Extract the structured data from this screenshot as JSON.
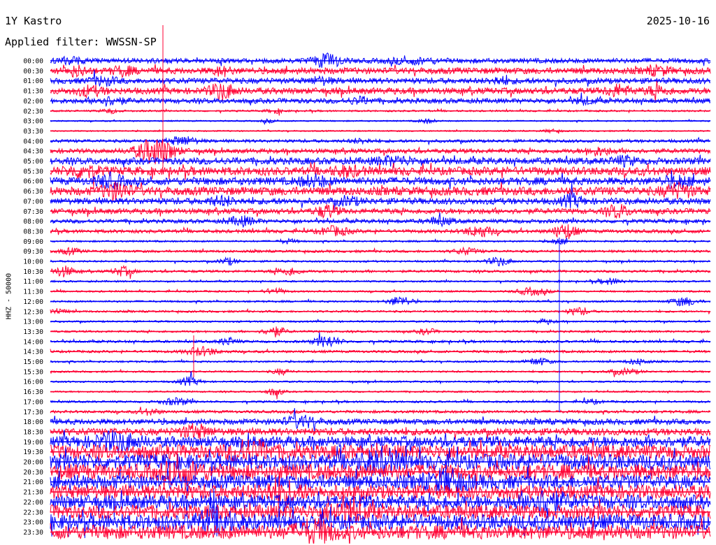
{
  "header": {
    "station": "1Y Kastro",
    "date": "2025-10-16",
    "filter": "Applied filter: WWSSN-SP"
  },
  "chart_data": {
    "type": "line",
    "title": "1Y Kastro",
    "subtitle": "Applied filter: WWSSN-SP",
    "ylabel": "HHZ - 50000",
    "xlabel": "",
    "x_range": [
      0,
      30
    ],
    "grid": false,
    "legend": "none",
    "colors": {
      "even_rows": "#0000ff",
      "odd_rows": "#ff0033",
      "text": "#000000",
      "background": "#ffffff"
    },
    "tick_labels": [
      "00:00",
      "00:30",
      "01:00",
      "01:30",
      "02:00",
      "02:30",
      "03:00",
      "03:30",
      "04:00",
      "04:30",
      "05:00",
      "05:30",
      "06:00",
      "06:30",
      "07:00",
      "07:30",
      "08:00",
      "08:30",
      "09:00",
      "09:30",
      "10:00",
      "10:30",
      "11:00",
      "11:30",
      "12:00",
      "12:30",
      "13:00",
      "13:30",
      "14:00",
      "14:30",
      "15:00",
      "15:30",
      "16:00",
      "16:30",
      "17:00",
      "17:30",
      "18:00",
      "18:30",
      "19:00",
      "19:30",
      "20:00",
      "20:30",
      "21:00",
      "21:30",
      "22:00",
      "22:30",
      "23:00",
      "23:30"
    ],
    "series": [
      {
        "label": "00:00",
        "noise": 3.5,
        "events": [
          [
            0.42,
            1.4,
            9
          ],
          [
            0.55,
            2.8,
            3
          ],
          [
            0.03,
            1.2,
            4
          ]
        ]
      },
      {
        "label": "00:30",
        "noise": 4.5,
        "events": [
          [
            0.04,
            1.0,
            6
          ],
          [
            0.11,
            1.0,
            5
          ],
          [
            0.26,
            0.8,
            5
          ],
          [
            0.92,
            1.2,
            5
          ]
        ]
      },
      {
        "label": "01:00",
        "noise": 4.0,
        "events": [
          [
            0.08,
            1.3,
            5
          ],
          [
            0.41,
            1.1,
            4
          ],
          [
            0.68,
            1.0,
            4
          ]
        ]
      },
      {
        "label": "01:30",
        "noise": 4.5,
        "events": [
          [
            0.06,
            1.4,
            5
          ],
          [
            0.26,
            1.2,
            10
          ],
          [
            0.86,
            1.2,
            7
          ],
          [
            0.92,
            1.0,
            6
          ]
        ]
      },
      {
        "label": "02:00",
        "noise": 3.5,
        "events": [
          [
            0.09,
            1.5,
            5
          ],
          [
            0.47,
            1.1,
            4
          ],
          [
            0.81,
            1.0,
            4
          ]
        ]
      },
      {
        "label": "02:30",
        "noise": 1.3,
        "events": [
          [
            0.09,
            0.8,
            3
          ],
          [
            0.34,
            0.7,
            3
          ]
        ]
      },
      {
        "label": "03:00",
        "noise": 1.0,
        "events": [
          [
            0.33,
            0.6,
            2
          ],
          [
            0.57,
            0.8,
            3
          ]
        ]
      },
      {
        "label": "03:30",
        "noise": 1.0,
        "events": [
          [
            0.76,
            0.8,
            2
          ]
        ]
      },
      {
        "label": "04:00",
        "noise": 2.2,
        "events": [
          [
            0.2,
            1.5,
            6
          ],
          [
            0.47,
            1.0,
            3
          ]
        ]
      },
      {
        "label": "04:30",
        "noise": 3.2,
        "events": [
          [
            0.16,
            2.0,
            18
          ],
          [
            0.83,
            1.3,
            5
          ]
        ]
      },
      {
        "label": "05:00",
        "noise": 4.8,
        "events": [
          [
            0.52,
            2.0,
            5
          ],
          [
            0.87,
            1.2,
            5
          ]
        ]
      },
      {
        "label": "05:30",
        "noise": 6.0,
        "events": [
          [
            0.05,
            1.6,
            7
          ],
          [
            0.45,
            1.4,
            5
          ]
        ]
      },
      {
        "label": "06:00",
        "noise": 5.5,
        "events": [
          [
            0.09,
            1.4,
            8
          ],
          [
            0.4,
            1.5,
            6
          ],
          [
            0.95,
            1.3,
            7
          ]
        ]
      },
      {
        "label": "06:30",
        "noise": 6.0,
        "events": [
          [
            0.1,
            1.4,
            10
          ],
          [
            0.95,
            1.5,
            8
          ]
        ]
      },
      {
        "label": "07:00",
        "noise": 4.5,
        "events": [
          [
            0.26,
            1.3,
            5
          ],
          [
            0.45,
            1.2,
            5
          ],
          [
            0.79,
            1.0,
            8
          ]
        ]
      },
      {
        "label": "07:30",
        "noise": 3.8,
        "events": [
          [
            0.42,
            1.0,
            8
          ],
          [
            0.86,
            1.0,
            8
          ]
        ]
      },
      {
        "label": "08:00",
        "noise": 2.8,
        "events": [
          [
            0.29,
            1.4,
            6
          ],
          [
            0.59,
            1.3,
            5
          ]
        ]
      },
      {
        "label": "08:30",
        "noise": 2.5,
        "events": [
          [
            0.43,
            1.6,
            6
          ],
          [
            0.65,
            1.5,
            7
          ],
          [
            0.78,
            1.1,
            10
          ]
        ]
      },
      {
        "label": "09:00",
        "noise": 1.3,
        "events": [
          [
            0.36,
            0.8,
            3
          ],
          [
            0.77,
            0.8,
            4
          ]
        ]
      },
      {
        "label": "09:30",
        "noise": 1.8,
        "events": [
          [
            0.03,
            1.0,
            4
          ],
          [
            0.63,
            1.2,
            4
          ]
        ]
      },
      {
        "label": "10:00",
        "noise": 1.4,
        "events": [
          [
            0.27,
            0.8,
            5
          ],
          [
            0.68,
            1.1,
            6
          ]
        ]
      },
      {
        "label": "10:30",
        "noise": 1.8,
        "events": [
          [
            0.02,
            1.0,
            7
          ],
          [
            0.11,
            0.9,
            6
          ],
          [
            0.36,
            1.2,
            5
          ]
        ]
      },
      {
        "label": "11:00",
        "noise": 1.3,
        "events": [
          [
            0.85,
            1.4,
            4
          ]
        ]
      },
      {
        "label": "11:30",
        "noise": 1.3,
        "events": [
          [
            0.34,
            1.0,
            4
          ],
          [
            0.73,
            1.5,
            5
          ]
        ]
      },
      {
        "label": "12:00",
        "noise": 1.4,
        "events": [
          [
            0.53,
            1.1,
            7
          ],
          [
            0.96,
            1.3,
            6
          ]
        ]
      },
      {
        "label": "12:30",
        "noise": 1.5,
        "events": [
          [
            0.01,
            0.8,
            4
          ],
          [
            0.8,
            1.0,
            5
          ]
        ]
      },
      {
        "label": "13:00",
        "noise": 1.3,
        "events": [
          [
            0.75,
            0.8,
            3
          ]
        ]
      },
      {
        "label": "13:30",
        "noise": 1.5,
        "events": [
          [
            0.34,
            1.0,
            7
          ],
          [
            0.57,
            0.8,
            4
          ]
        ]
      },
      {
        "label": "14:00",
        "noise": 1.8,
        "events": [
          [
            0.27,
            0.8,
            5
          ],
          [
            0.42,
            1.2,
            8
          ]
        ]
      },
      {
        "label": "14:30",
        "noise": 1.8,
        "events": [
          [
            0.23,
            1.6,
            6
          ]
        ]
      },
      {
        "label": "15:00",
        "noise": 1.4,
        "events": [
          [
            0.74,
            1.1,
            5
          ],
          [
            0.89,
            1.0,
            4
          ]
        ]
      },
      {
        "label": "15:30",
        "noise": 1.3,
        "events": [
          [
            0.35,
            0.8,
            4
          ],
          [
            0.87,
            1.6,
            4
          ]
        ]
      },
      {
        "label": "16:00",
        "noise": 1.3,
        "events": [
          [
            0.21,
            1.0,
            6
          ]
        ]
      },
      {
        "label": "16:30",
        "noise": 1.2,
        "events": [
          [
            0.34,
            0.7,
            5
          ]
        ]
      },
      {
        "label": "17:00",
        "noise": 1.5,
        "events": [
          [
            0.19,
            1.4,
            5
          ],
          [
            0.82,
            0.8,
            3
          ]
        ]
      },
      {
        "label": "17:30",
        "noise": 2.0,
        "events": [
          [
            0.15,
            0.9,
            4
          ]
        ]
      },
      {
        "label": "18:00",
        "noise": 4.0,
        "events": [
          [
            0.38,
            1.8,
            7
          ]
        ]
      },
      {
        "label": "18:30",
        "noise": 5.0,
        "events": [
          [
            0.22,
            1.5,
            8
          ]
        ]
      },
      {
        "label": "19:00",
        "noise": 8.0,
        "events": [
          [
            0.1,
            2.0,
            10
          ]
        ]
      },
      {
        "label": "19:30",
        "noise": 10.0,
        "events": [
          [
            0.3,
            2.0,
            12
          ]
        ]
      },
      {
        "label": "20:00",
        "noise": 11.0,
        "events": [
          [
            0.5,
            2.0,
            12
          ]
        ]
      },
      {
        "label": "20:30",
        "noise": 11.0,
        "events": [
          [
            0.2,
            2.0,
            12
          ]
        ]
      },
      {
        "label": "21:00",
        "noise": 10.0,
        "events": [
          [
            0.6,
            2.0,
            12
          ]
        ]
      },
      {
        "label": "21:30",
        "noise": 10.0,
        "events": [
          [
            0.35,
            2.0,
            12
          ]
        ]
      },
      {
        "label": "22:00",
        "noise": 10.0,
        "events": [
          [
            0.75,
            2.0,
            12
          ]
        ]
      },
      {
        "label": "22:30",
        "noise": 10.0,
        "events": [
          [
            0.45,
            2.0,
            12
          ]
        ]
      },
      {
        "label": "23:00",
        "noise": 11.0,
        "events": [
          [
            0.25,
            2.0,
            12
          ]
        ]
      },
      {
        "label": "23:30",
        "noise": 10.0,
        "events": [
          [
            0.4,
            2.0,
            12
          ]
        ]
      }
    ]
  }
}
